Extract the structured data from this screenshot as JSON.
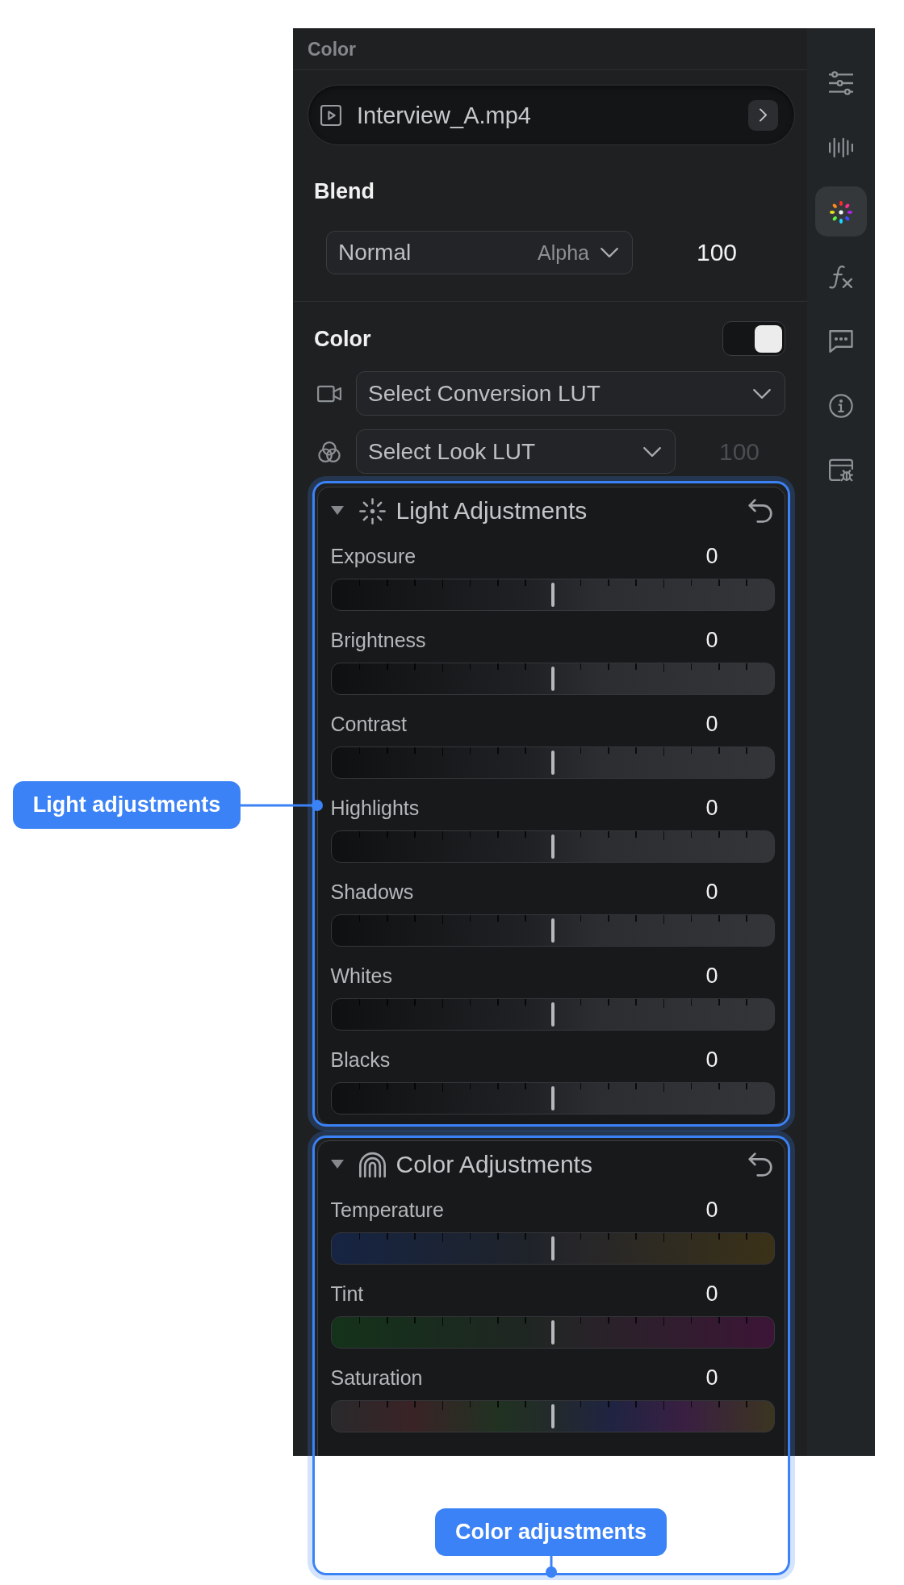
{
  "panel": {
    "title": "Color"
  },
  "clip": {
    "name": "Interview_A.mp4"
  },
  "blend": {
    "heading": "Blend",
    "mode": "Normal",
    "channel": "Alpha",
    "opacity": "100"
  },
  "color": {
    "heading": "Color",
    "on": true,
    "conversion_lut": {
      "label": "Select Conversion LUT"
    },
    "look_lut": {
      "label": "Select Look LUT",
      "intensity": {
        "value": "100",
        "disabled": true
      }
    }
  },
  "sections": [
    {
      "title": "Light Adjustments",
      "kind": "light",
      "expanded": true,
      "sliders": [
        {
          "label": "Exposure",
          "reading": "0",
          "level": 0.5,
          "kind": "neutral"
        },
        {
          "label": "Brightness",
          "reading": "0",
          "level": 0.5,
          "kind": "neutral"
        },
        {
          "label": "Contrast",
          "reading": "0",
          "level": 0.5,
          "kind": "neutral"
        },
        {
          "label": "Highlights",
          "reading": "0",
          "level": 0.5,
          "kind": "neutral"
        },
        {
          "label": "Shadows",
          "reading": "0",
          "level": 0.5,
          "kind": "neutral"
        },
        {
          "label": "Whites",
          "reading": "0",
          "level": 0.5,
          "kind": "neutral"
        },
        {
          "label": "Blacks",
          "reading": "0",
          "level": 0.5,
          "kind": "neutral"
        }
      ]
    },
    {
      "title": "Color Adjustments",
      "kind": "color",
      "expanded": true,
      "sliders": [
        {
          "label": "Temperature",
          "reading": "0",
          "level": 0.5,
          "kind": "temperature"
        },
        {
          "label": "Tint",
          "reading": "0",
          "level": 0.5,
          "kind": "tint"
        },
        {
          "label": "Saturation",
          "reading": "0",
          "level": 0.5,
          "kind": "saturation"
        }
      ]
    }
  ],
  "sidebar": {
    "items": [
      {
        "kind": "sliders",
        "selected": false
      },
      {
        "kind": "waveform",
        "selected": false
      },
      {
        "kind": "color",
        "selected": true
      },
      {
        "kind": "function",
        "selected": false
      },
      {
        "kind": "comments",
        "selected": false
      },
      {
        "kind": "info",
        "selected": false
      },
      {
        "kind": "debug",
        "selected": false
      }
    ]
  },
  "annotations": [
    {
      "label": "Light adjustments",
      "kind": "left"
    },
    {
      "label": "Color adjustments",
      "kind": "below"
    }
  ]
}
